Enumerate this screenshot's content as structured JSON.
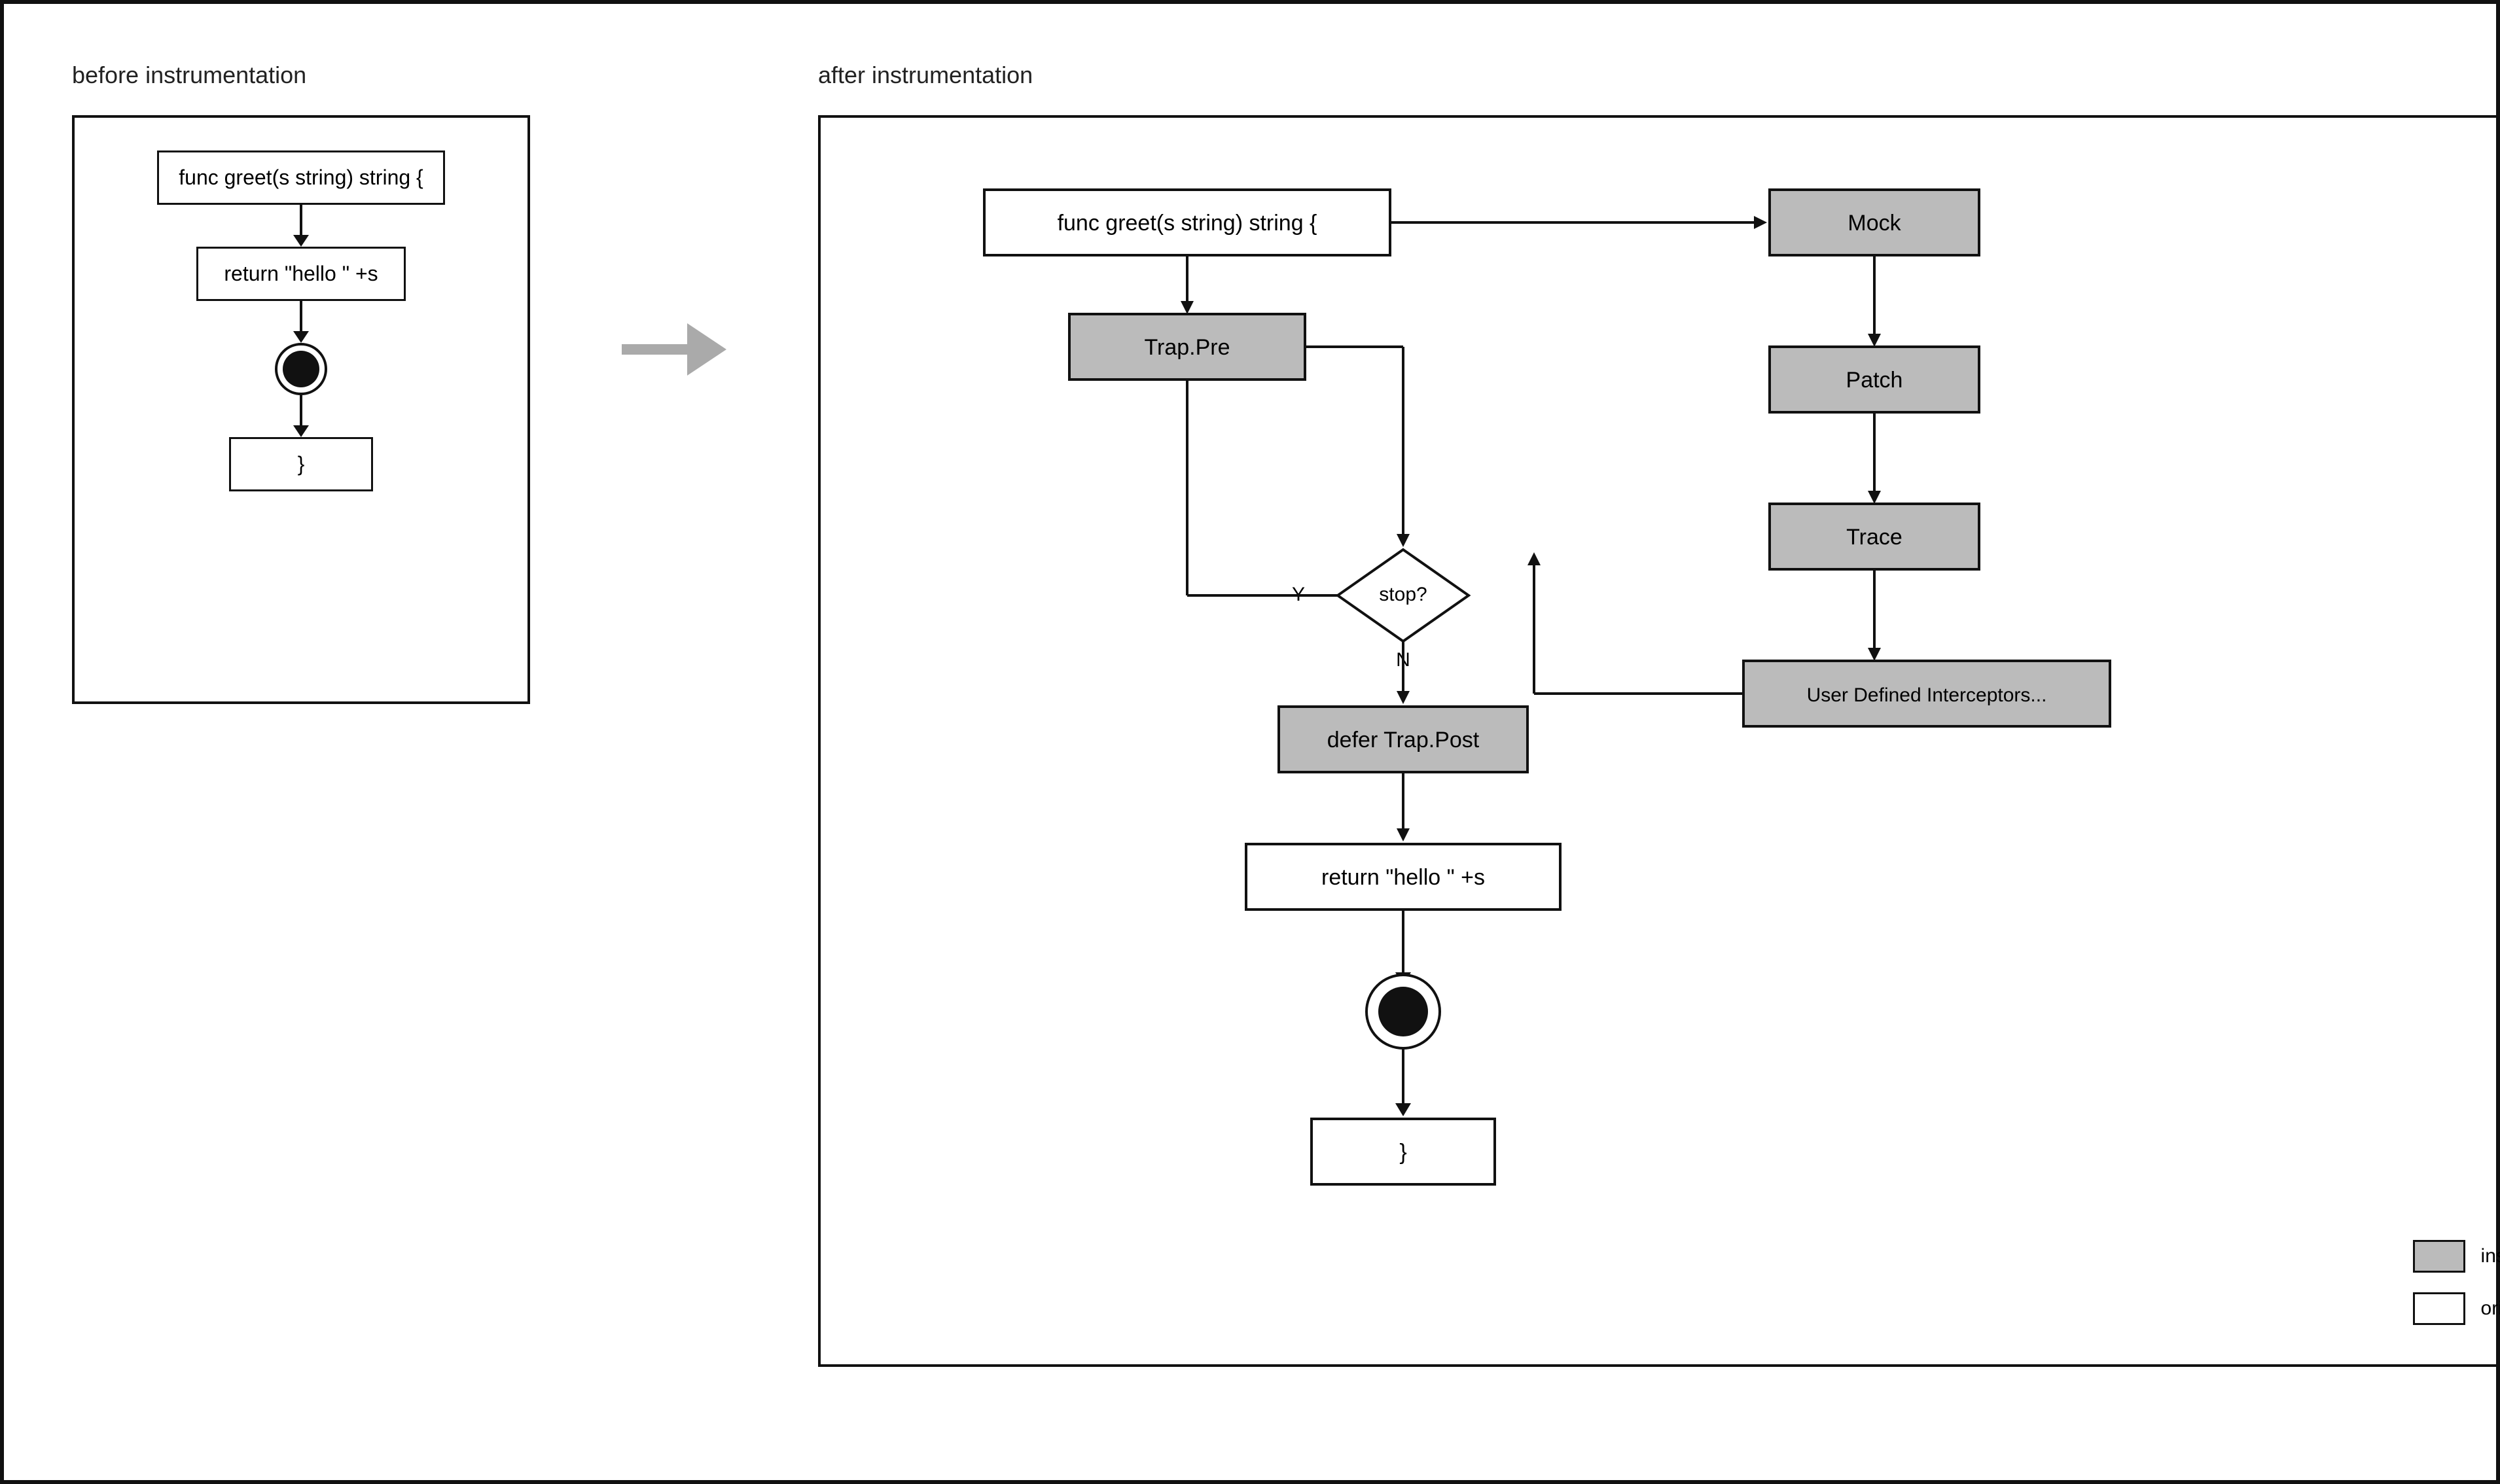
{
  "left": {
    "label": "before instrumentation",
    "nodes": {
      "func_decl": "func greet(s string) string {",
      "return_stmt": "return \"hello \" +s",
      "close_brace": "}"
    }
  },
  "right": {
    "label": "after instrumentation",
    "nodes": {
      "func_decl": "func greet(s string) string {",
      "trap_pre": "Trap.Pre",
      "stop_diamond": "stop?",
      "y_label": "Y",
      "n_label": "N",
      "defer_trap": "defer Trap.Post",
      "return_stmt": "return \"hello \" +s",
      "close_brace": "}",
      "mock": "Mock",
      "patch": "Patch",
      "trace": "Trace",
      "user_interceptors": "User Defined Interceptors..."
    },
    "legend": {
      "gray_label": "inserted by xgo",
      "white_label": "original code"
    }
  }
}
